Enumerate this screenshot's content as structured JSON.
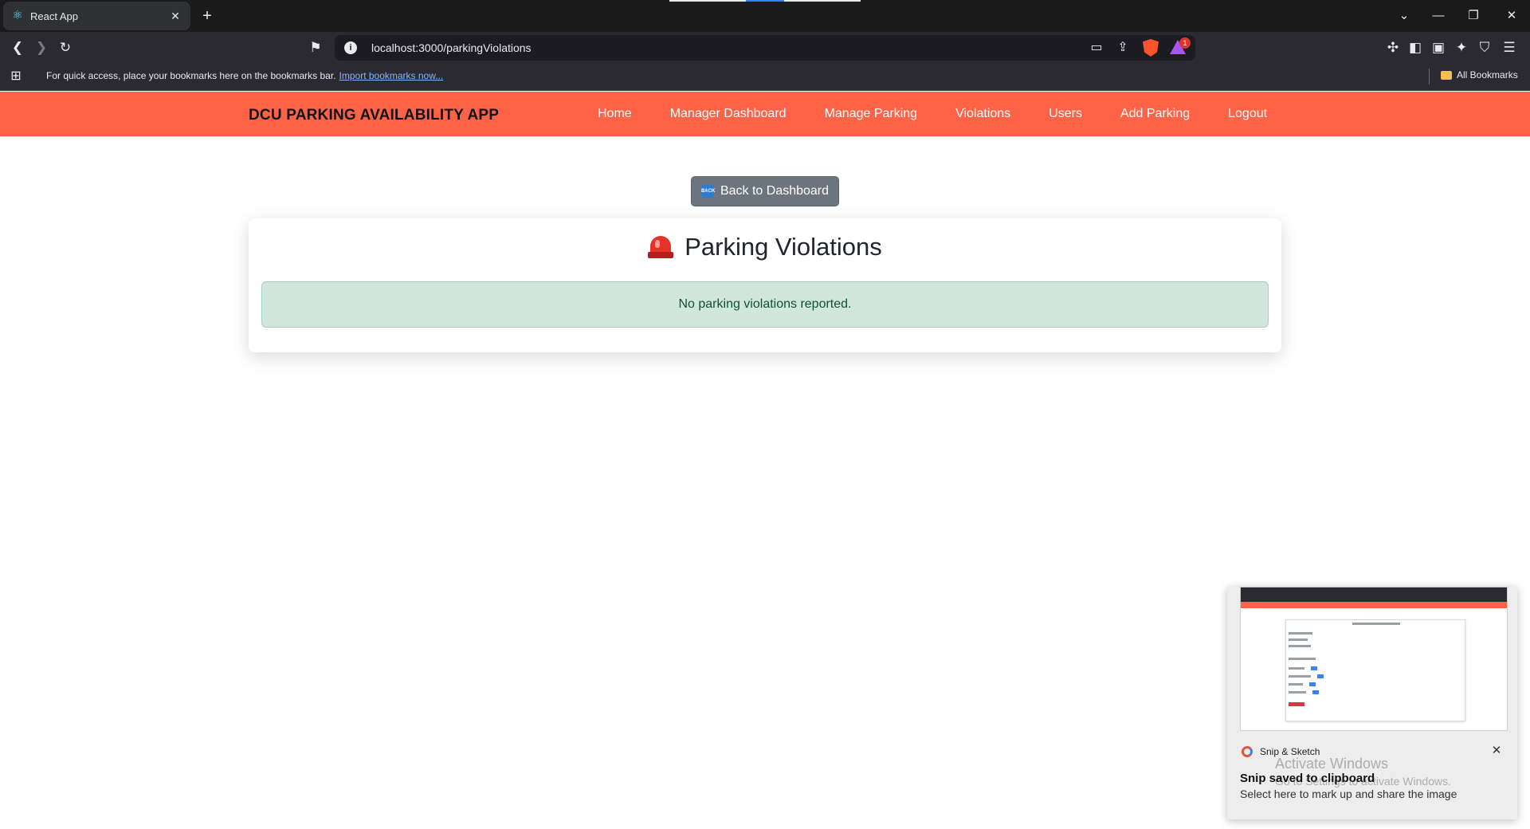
{
  "browser": {
    "tab_title": "React App",
    "url": "localhost:3000/parkingViolations",
    "bookmarks_bar_text": "For quick access, place your bookmarks here on the bookmarks bar.",
    "bookmarks_import_link": "Import bookmarks now...",
    "all_bookmarks_label": "All Bookmarks",
    "rewards_badge": "1"
  },
  "navbar": {
    "brand": "DCU PARKING AVAILABILITY APP",
    "links": [
      "Home",
      "Manager Dashboard",
      "Manage Parking",
      "Violations",
      "Users",
      "Add Parking",
      "Logout"
    ]
  },
  "page": {
    "back_button_label": "Back to Dashboard",
    "back_icon_text": "BACK",
    "title": "Parking Violations",
    "empty_message": "No parking violations reported."
  },
  "notification": {
    "app_name": "Snip & Sketch",
    "title": "Snip saved to clipboard",
    "body": "Select here to mark up and share the image"
  },
  "watermark": {
    "line1": "Activate Windows",
    "line2": "Go to Settings to activate Windows."
  },
  "colors": {
    "navbar_bg": "#ff6347",
    "alert_bg": "#d1e7dd",
    "alert_text": "#0f5132",
    "button_bg": "#6c757d"
  }
}
